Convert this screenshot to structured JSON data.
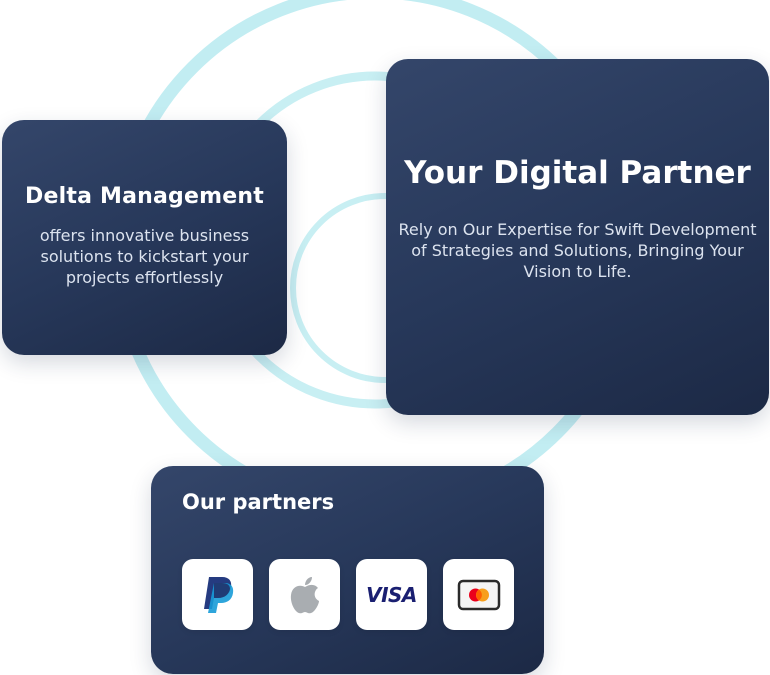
{
  "colors": {
    "card_bg_top": "#34466a",
    "card_bg_bottom": "#1c2945",
    "ring": "#c2edf2",
    "text": "#ffffff"
  },
  "cards": {
    "delta": {
      "title": "Delta Management",
      "body": "offers innovative business solutions to kickstart your projects effortlessly"
    },
    "digital": {
      "title": "Your Digital Partner",
      "body": "Rely on Our Expertise for Swift Development of Strategies and Solutions, Bringing Your Vision to Life."
    },
    "partners": {
      "title": "Our partners",
      "logos": [
        {
          "name": "paypal-icon"
        },
        {
          "name": "apple-icon"
        },
        {
          "name": "visa-icon",
          "text": "VISA"
        },
        {
          "name": "mastercard-icon"
        }
      ]
    }
  }
}
